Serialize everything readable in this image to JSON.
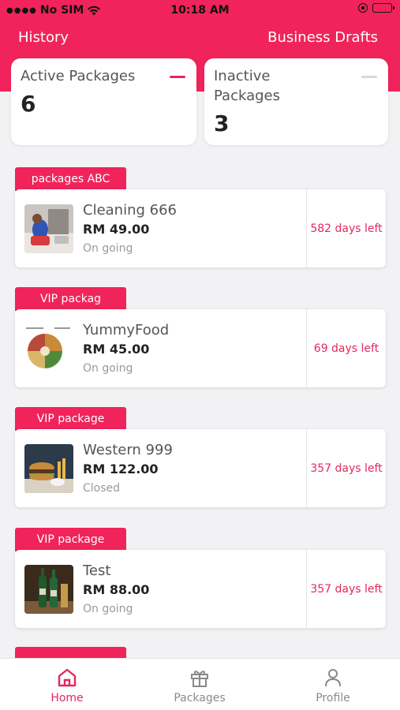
{
  "status_bar": {
    "carrier": "No SIM",
    "time": "10:18 AM"
  },
  "nav": {
    "left_label": "History",
    "right_label": "Business Drafts"
  },
  "summary": {
    "active": {
      "label": "Active Packages",
      "count": "6"
    },
    "inactive": {
      "label": "Inactive Packages",
      "count": "3"
    }
  },
  "packages": [
    {
      "group": "packages ABC",
      "name": "Cleaning 666",
      "price": "RM 49.00",
      "status": "On going",
      "days_left": "582 days left",
      "thumb_icon": "cleaning-photo"
    },
    {
      "group": "VIP packag",
      "name": "YummyFood",
      "price": "RM 45.00",
      "status": "On going",
      "days_left": "69 days left",
      "thumb_icon": "food-plate-photo"
    },
    {
      "group": "VIP package",
      "name": "Western 999",
      "price": "RM 122.00",
      "status": "Closed",
      "days_left": "357 days left",
      "thumb_icon": "burger-photo"
    },
    {
      "group": "VIP package",
      "name": "Test",
      "price": "RM 88.00",
      "status": "On going",
      "days_left": "357 days left",
      "thumb_icon": "bottles-photo"
    }
  ],
  "tabbar": {
    "home": "Home",
    "packages": "Packages",
    "profile": "Profile"
  },
  "colors": {
    "accent": "#f0245a",
    "days_text": "#e3285d"
  }
}
